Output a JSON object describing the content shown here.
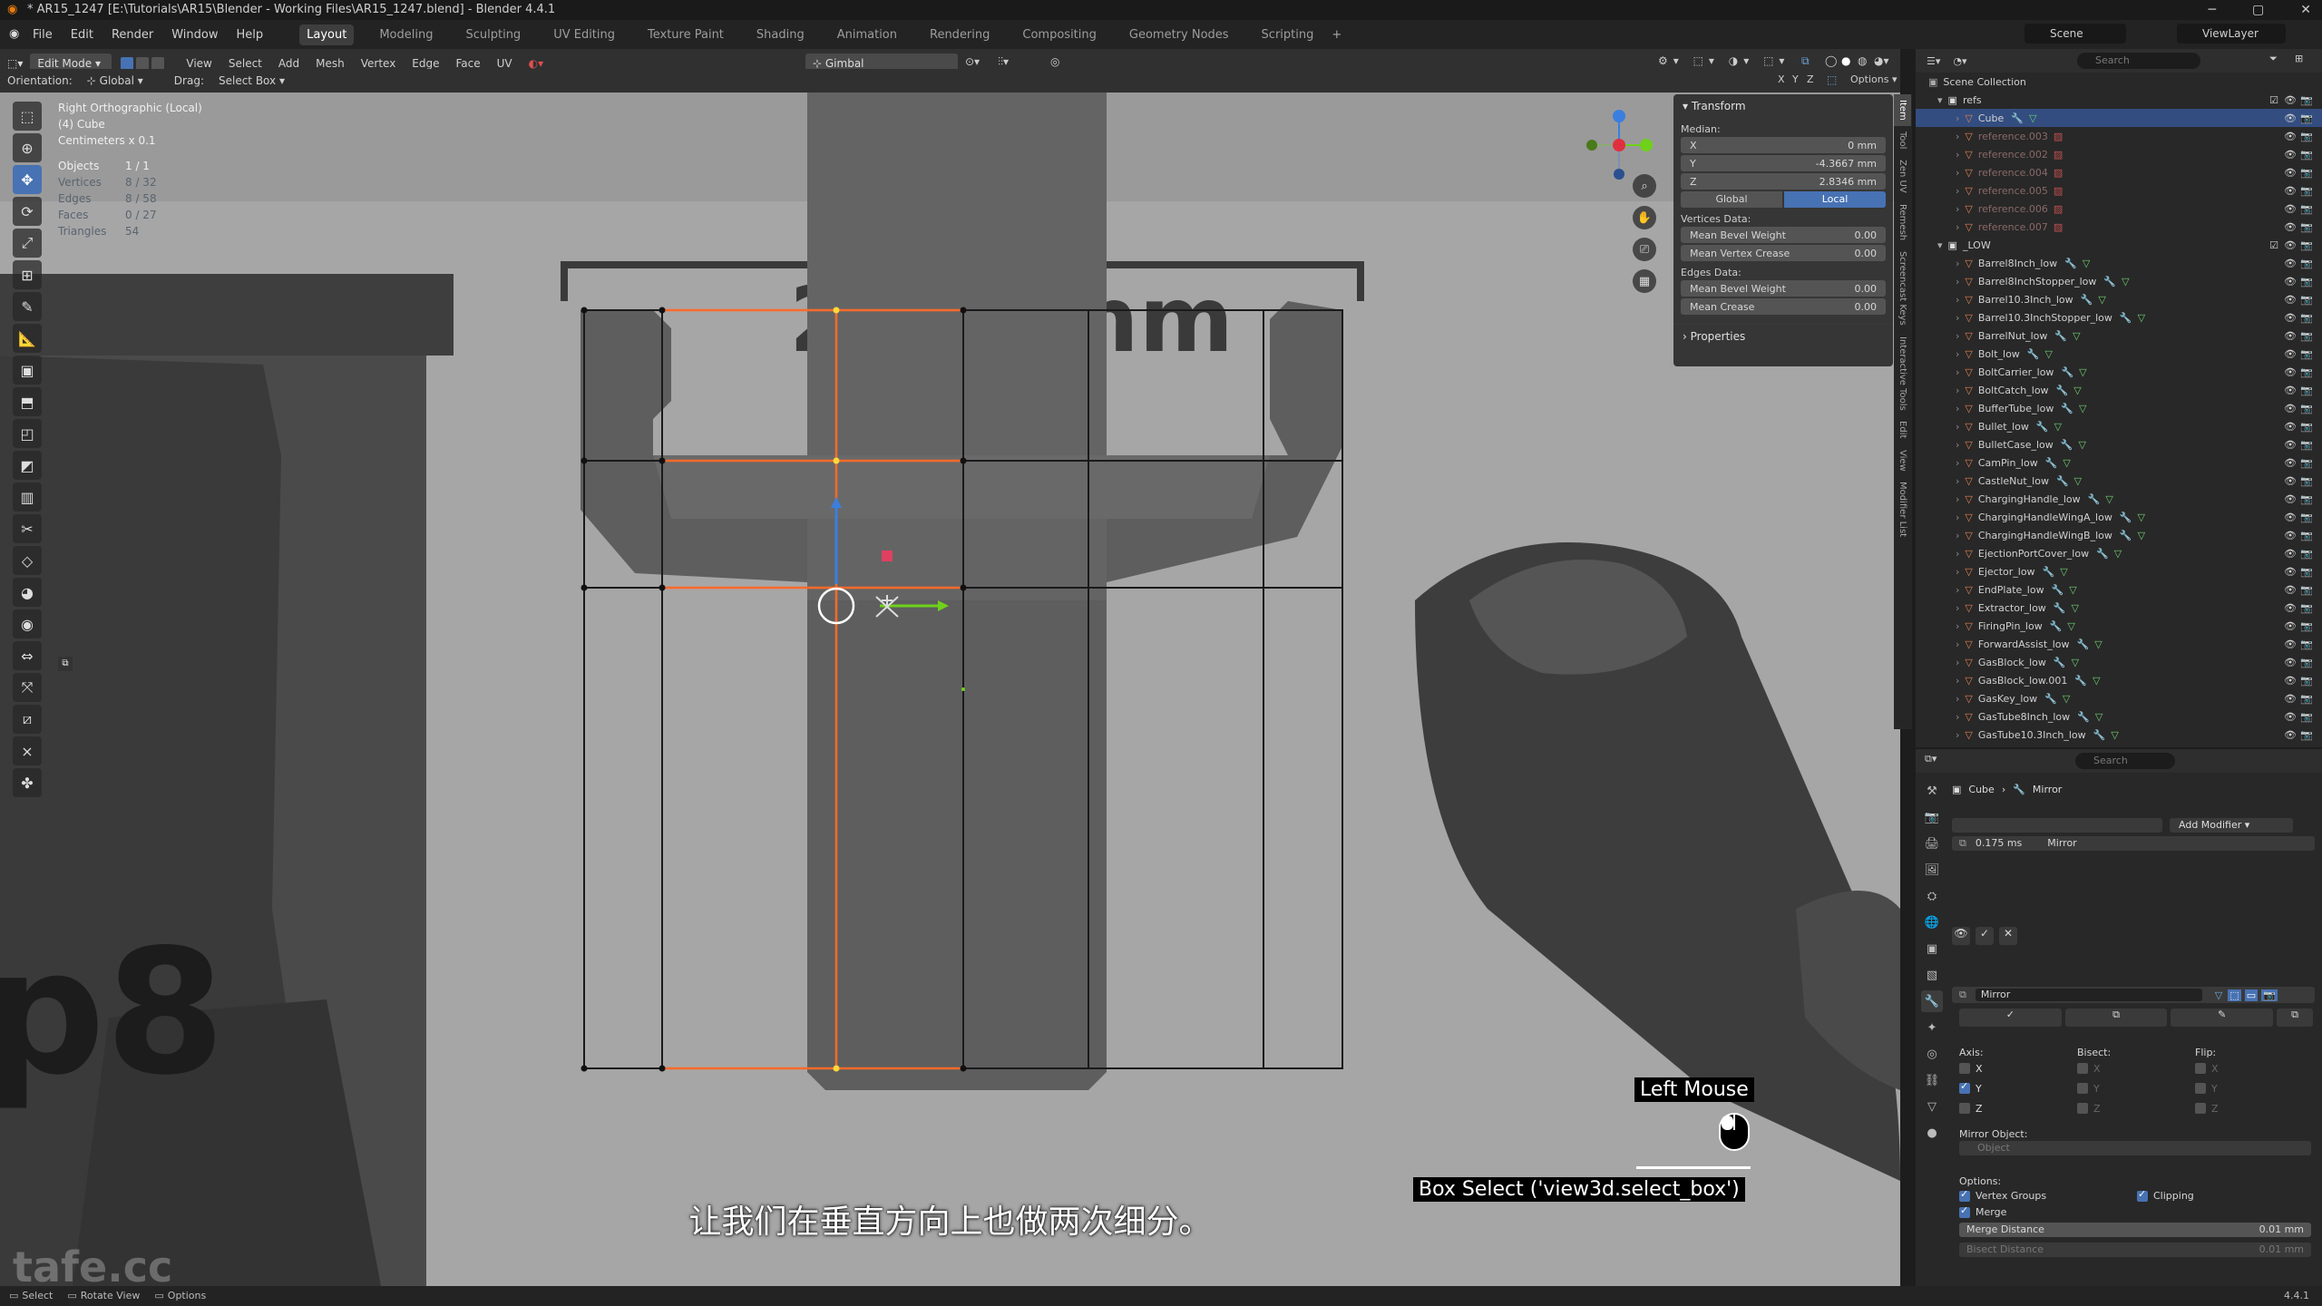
{
  "window": {
    "title": "* AR15_1247 [E:\\Tutorials\\AR15\\Blender - Working Files\\AR15_1247.blend] - Blender 4.4.1"
  },
  "menubar": {
    "menus": [
      "File",
      "Edit",
      "Render",
      "Window",
      "Help"
    ],
    "workspaces": [
      "Layout",
      "Modeling",
      "Sculpting",
      "UV Editing",
      "Texture Paint",
      "Shading",
      "Animation",
      "Rendering",
      "Compositing",
      "Geometry Nodes",
      "Scripting"
    ],
    "add_tab": "+",
    "scene": "Scene",
    "view_layer": "ViewLayer"
  },
  "viewport_header": {
    "mode": "Edit Mode",
    "menus": [
      "View",
      "Select",
      "Add",
      "Mesh",
      "Vertex",
      "Edge",
      "Face",
      "UV"
    ],
    "transform_orientation": "Gimbal",
    "options": "Options",
    "xyz": [
      "X",
      "Y",
      "Z"
    ]
  },
  "orient_row": {
    "orientation_label": "Orientation:",
    "orientation_value": "Global",
    "drag_label": "Drag:",
    "drag_value": "Select Box"
  },
  "viewport_info": {
    "view": "Right Orthographic (Local)",
    "object": "(4) Cube",
    "units": "Centimeters x 0.1",
    "stats": [
      {
        "label": "Objects",
        "value": "1 / 1"
      },
      {
        "label": "Vertices",
        "value": "8 / 32"
      },
      {
        "label": "Edges",
        "value": "8 / 58"
      },
      {
        "label": "Faces",
        "value": "0 / 27"
      },
      {
        "label": "Triangles",
        "value": "54"
      }
    ]
  },
  "reference_text": "26.2 mm",
  "npanel": {
    "transform_title": "Transform",
    "median_label": "Median:",
    "fields": [
      {
        "label": "X",
        "value": "0 mm"
      },
      {
        "label": "Y",
        "value": "-4.3667 mm"
      },
      {
        "label": "Z",
        "value": "2.8346 mm"
      }
    ],
    "global_btn": "Global",
    "local_btn": "Local",
    "vertices_data": "Vertices Data:",
    "vertex_fields": [
      {
        "label": "Mean Bevel Weight",
        "value": "0.00"
      },
      {
        "label": "Mean Vertex Crease",
        "value": "0.00"
      }
    ],
    "edges_data": "Edges Data:",
    "edge_fields": [
      {
        "label": "Mean Bevel Weight",
        "value": "0.00"
      },
      {
        "label": "Mean Crease",
        "value": "0.00"
      }
    ],
    "properties_title": "Properties"
  },
  "vtabs": [
    "Item",
    "Tool",
    "Zen UV",
    "Remesh",
    "Screencast Keys",
    "Interactive Tools",
    "Edit",
    "View",
    "Modifier List"
  ],
  "outliner": {
    "search_placeholder": "Search",
    "scene_collection": "Scene Collection",
    "refs_collection": "refs",
    "refs_items": [
      {
        "name": "Cube",
        "selected": true
      },
      {
        "name": "reference.003",
        "selected": false
      },
      {
        "name": "reference.002",
        "selected": false
      },
      {
        "name": "reference.004",
        "selected": false
      },
      {
        "name": "reference.005",
        "selected": false
      },
      {
        "name": "reference.006",
        "selected": false
      },
      {
        "name": "reference.007",
        "selected": false
      }
    ],
    "low_collection": "_LOW",
    "low_items": [
      "Barrel8Inch_low",
      "Barrel8InchStopper_low",
      "Barrel10.3Inch_low",
      "Barrel10.3InchStopper_low",
      "BarrelNut_low",
      "Bolt_low",
      "BoltCarrier_low",
      "BoltCatch_low",
      "BufferTube_low",
      "Bullet_low",
      "BulletCase_low",
      "CamPin_low",
      "CastleNut_low",
      "ChargingHandle_low",
      "ChargingHandleWingA_low",
      "ChargingHandleWingB_low",
      "EjectionPortCover_low",
      "Ejector_low",
      "EndPlate_low",
      "Extractor_low",
      "FiringPin_low",
      "ForwardAssist_low",
      "GasBlock_low",
      "GasBlock_low.001",
      "GasKey_low",
      "GasTube8Inch_low",
      "GasTube10.3Inch_low"
    ]
  },
  "properties": {
    "search_placeholder": "Search",
    "breadcrumb_object": "Cube",
    "breadcrumb_modifier": "Mirror",
    "add_modifier": "Add Modifier",
    "modifier_time": "0.175 ms",
    "modifier_name_short": "Mirror",
    "modifier_name": "Mirror",
    "axis_label": "Axis:",
    "bisect_label": "Bisect:",
    "flip_label": "Flip:",
    "axes": [
      {
        "axis": "X",
        "checked": false
      },
      {
        "axis": "Y",
        "checked": true
      },
      {
        "axis": "Z",
        "checked": false
      }
    ],
    "mirror_object_label": "Mirror Object:",
    "mirror_object_placeholder": "Object",
    "options_label": "Options:",
    "vertex_groups": "Vertex Groups",
    "clipping": "Clipping",
    "merge": "Merge",
    "merge_distance_label": "Merge Distance",
    "merge_distance_value": "0.01 mm",
    "bisect_distance_label": "Bisect Distance",
    "bisect_distance_value": "0.01 mm"
  },
  "statusbar": {
    "items": [
      "Select",
      "Rotate View",
      "Options"
    ],
    "version": "4.4.1"
  },
  "overlays": {
    "key_hint": "Left Mouse",
    "operator": "Box Select ('view3d.select_box')",
    "subtitle": "让我们在垂直方向上也做两次细分。",
    "watermark": "tafe.cc"
  },
  "colors": {
    "accent": "#4772b3",
    "selection": "#334d80",
    "edge_selected": "#ff6a2a",
    "vertex_selected": "#ffd93a"
  }
}
